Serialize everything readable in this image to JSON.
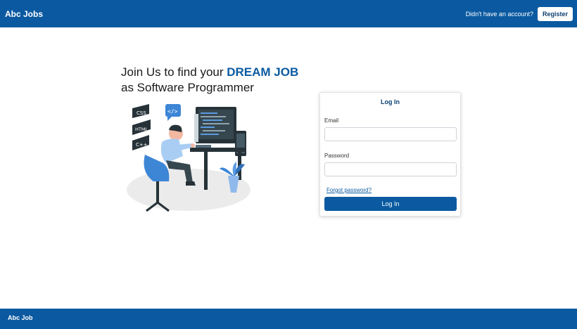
{
  "header": {
    "brand": "Abc Jobs",
    "no_account_text": "Didn't have an account?",
    "register_label": "Register"
  },
  "hero": {
    "title_part1": "Join Us to find your ",
    "title_accent": "DREAM JOB",
    "title_line2": "as Software Programmer"
  },
  "illustration": {
    "badges": [
      "CSS",
      "HTML",
      "C++"
    ],
    "code_icon": "</>"
  },
  "login": {
    "title": "Log In",
    "email_label": "Email",
    "email_value": "",
    "password_label": "Password",
    "password_value": "",
    "forgot_label": "Forgot password?",
    "submit_label": "Log In"
  },
  "footer": {
    "brand": "Abc Job"
  },
  "colors": {
    "primary": "#0b5aa1",
    "accent_text": "#0b3f73"
  }
}
